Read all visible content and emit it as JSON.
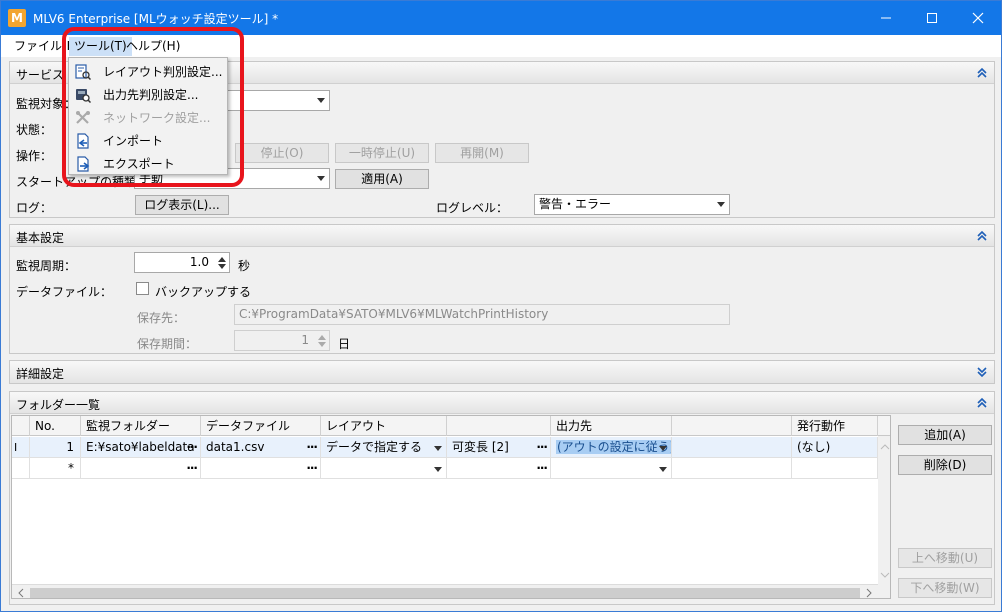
{
  "window": {
    "title": "MLV6 Enterprise [MLウォッチ設定ツール] *",
    "app_icon_letter": "M",
    "minimize": "–",
    "maximize": "☐",
    "close": "✕"
  },
  "menubar": {
    "file": "ファイル(F)",
    "tools": "ツール(T)",
    "help": "ヘルプ(H)"
  },
  "tools_menu": {
    "items": [
      {
        "label": "レイアウト判別設定...",
        "enabled": true,
        "icon": "layout-detect-icon"
      },
      {
        "label": "出力先判別設定...",
        "enabled": true,
        "icon": "output-detect-icon"
      },
      {
        "label": "ネットワーク設定...",
        "enabled": false,
        "icon": "network-tools-icon"
      },
      {
        "label": "インポート",
        "enabled": true,
        "icon": "import-icon"
      },
      {
        "label": "エクスポート",
        "enabled": true,
        "icon": "export-icon"
      }
    ]
  },
  "service": {
    "title": "サービス",
    "target_label": "監視対象：",
    "status_label": "状態：",
    "operation_label": "操作：",
    "stop_button": "停止(O)",
    "pause_button": "一時停止(U)",
    "resume_button": "再開(M)",
    "startup_label": "スタートアップの種類：",
    "startup_value": "手動",
    "apply_button": "適用(A)",
    "log_label": "ログ：",
    "log_button": "ログ表示(L)...",
    "loglevel_label": "ログレベル：",
    "loglevel_value": "警告・エラー"
  },
  "basic": {
    "title": "基本設定",
    "interval_label": "監視周期：",
    "interval_value": "1.0",
    "interval_unit": "秒",
    "datafile_label": "データファイル：",
    "backup_label": "バックアップする",
    "save_to_label": "保存先：",
    "save_to_value": "C:¥ProgramData¥SATO¥MLV6¥MLWatchPrintHistory",
    "retention_label": "保存期間：",
    "retention_value": "1",
    "retention_unit": "日"
  },
  "detail": {
    "title": "詳細設定"
  },
  "folders": {
    "title": "フォルダー一覧",
    "columns": [
      "No.",
      "監視フォルダー",
      "データファイル",
      "レイアウト",
      "",
      "出力先",
      "",
      "発行動作"
    ],
    "rows": [
      {
        "indicator": "I",
        "no": "1",
        "folder": "E:¥sato¥labeldata",
        "datafile": "data1.csv",
        "layout": "データで指定する",
        "layout2": "可変長 [2]",
        "output": "(アウトの設定に従う)",
        "action": "(なし)"
      },
      {
        "indicator": "",
        "no": "*",
        "folder": "",
        "datafile": "",
        "layout": "",
        "layout2": "",
        "output": "",
        "action": ""
      }
    ],
    "add_button": "追加(A)",
    "delete_button": "削除(D)",
    "up_button": "上へ移動(U)",
    "down_button": "下へ移動(W)"
  }
}
